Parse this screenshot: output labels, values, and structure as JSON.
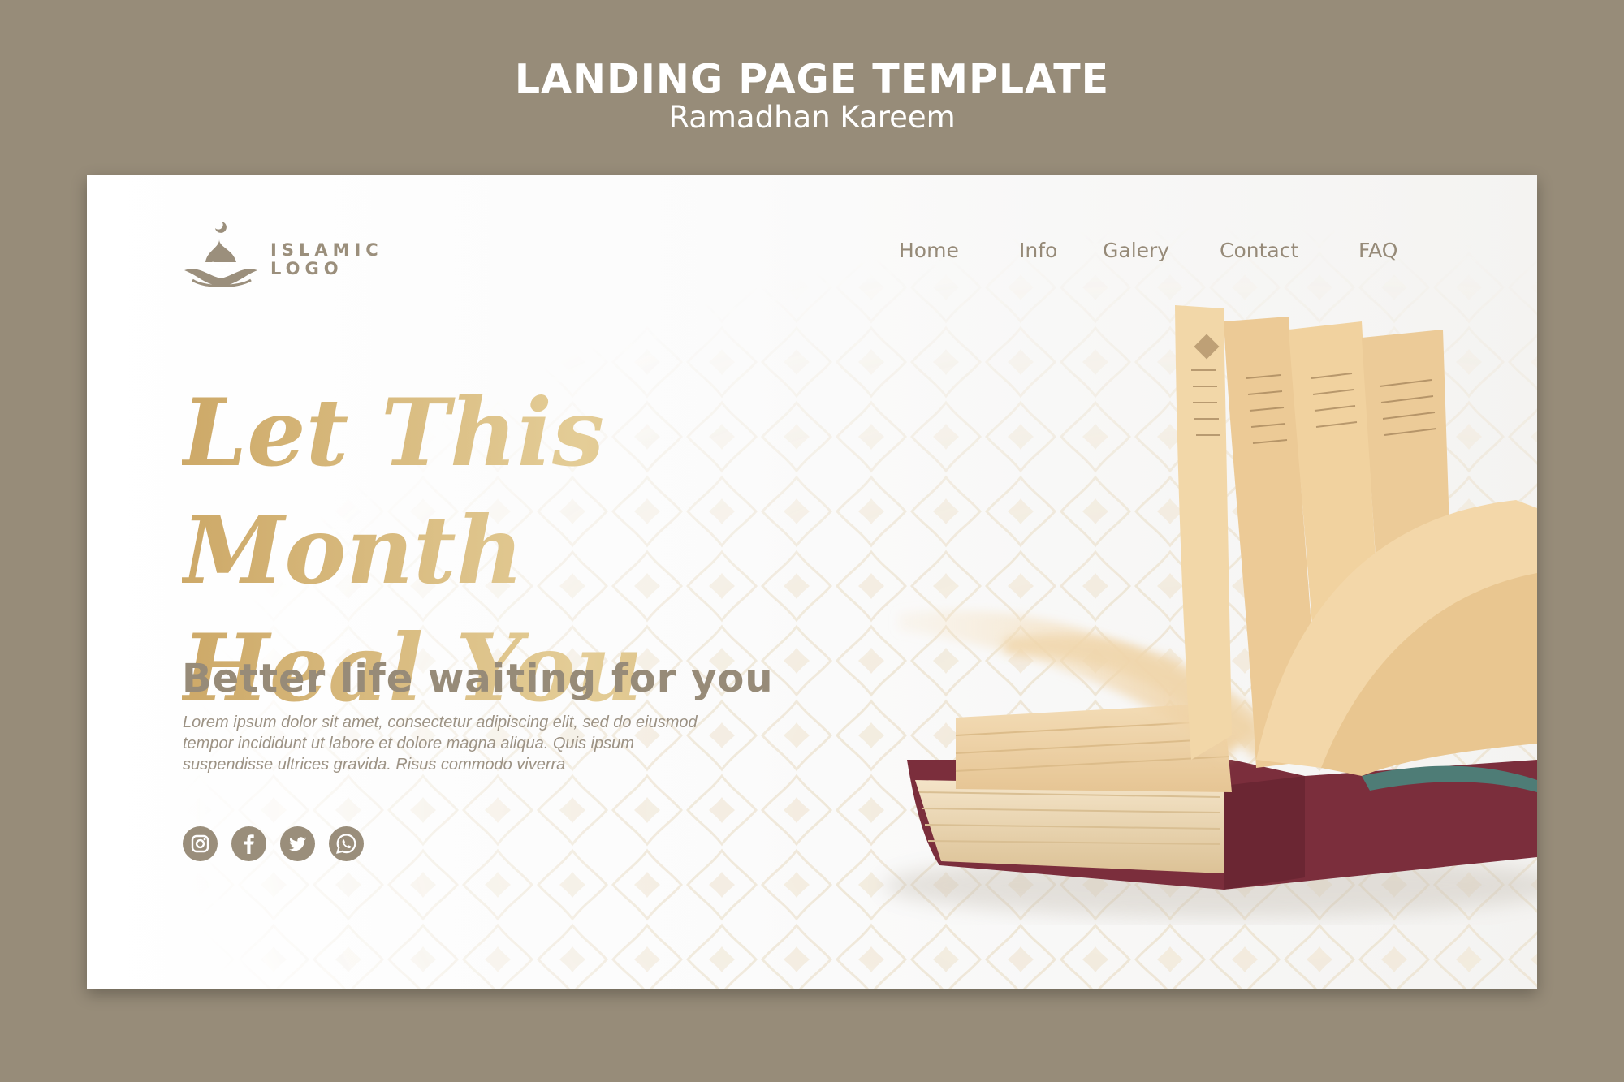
{
  "header": {
    "title": "LANDING PAGE TEMPLATE",
    "subtitle": "Ramadhan Kareem"
  },
  "logo": {
    "line1": "ISLAMIC",
    "line2": "LOGO",
    "icon": "mosque-dome-icon"
  },
  "nav": {
    "items": [
      {
        "label": "Home"
      },
      {
        "label": "Info"
      },
      {
        "label": "Galery"
      },
      {
        "label": "Contact"
      },
      {
        "label": "FAQ"
      }
    ]
  },
  "hero": {
    "title_line1": "Let This Month",
    "title_line2": "Heal You",
    "subtitle": "Better life waiting for you",
    "body_line1": "Lorem ipsum dolor sit amet, consectetur adipiscing elit, sed do eiusmod",
    "body_line2": "tempor incididunt ut labore et dolore magna aliqua. Quis ipsum",
    "body_line3": "suspendisse ultrices gravida. Risus commodo viverra"
  },
  "socials": [
    {
      "icon": "instagram-icon"
    },
    {
      "icon": "facebook-icon"
    },
    {
      "icon": "twitter-icon"
    },
    {
      "icon": "whatsapp-icon"
    }
  ],
  "colors": {
    "page_background": "#978c79",
    "gold": "#d2b476",
    "taupe": "#978b78",
    "book_cover": "#7b2e3c"
  }
}
